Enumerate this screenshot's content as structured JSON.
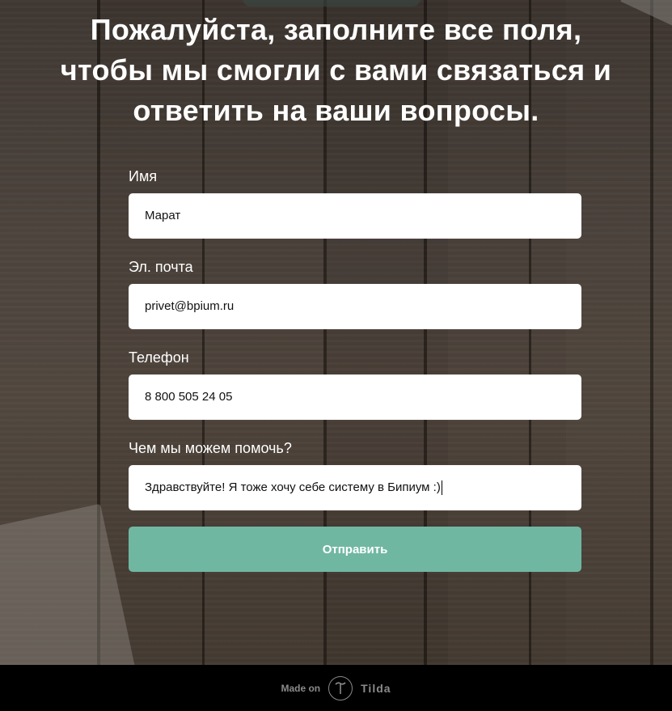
{
  "page": {
    "heading_line1": "Пожалуйста, заполните все поля,",
    "heading_line2": "чтобы мы смогли с вами связаться и",
    "heading_line3": "ответить на ваши вопросы."
  },
  "form": {
    "fields": [
      {
        "label": "Имя",
        "value": "Марат"
      },
      {
        "label": "Эл. почта",
        "value": "privet@bpium.ru"
      },
      {
        "label": "Телефон",
        "value": "8 800 505 24 05"
      },
      {
        "label": "Чем мы можем помочь?",
        "value": "Здравствуйте! Я тоже хочу себе систему в Бипиум :)"
      }
    ],
    "submit_label": "Отправить"
  },
  "footer": {
    "made_on": "Made on",
    "brand": "Tilda",
    "logo_icon": "tilda-logo-icon"
  },
  "colors": {
    "accent": "#70b7a2",
    "footer_bg": "#000000",
    "heading_text": "#ffffff"
  }
}
